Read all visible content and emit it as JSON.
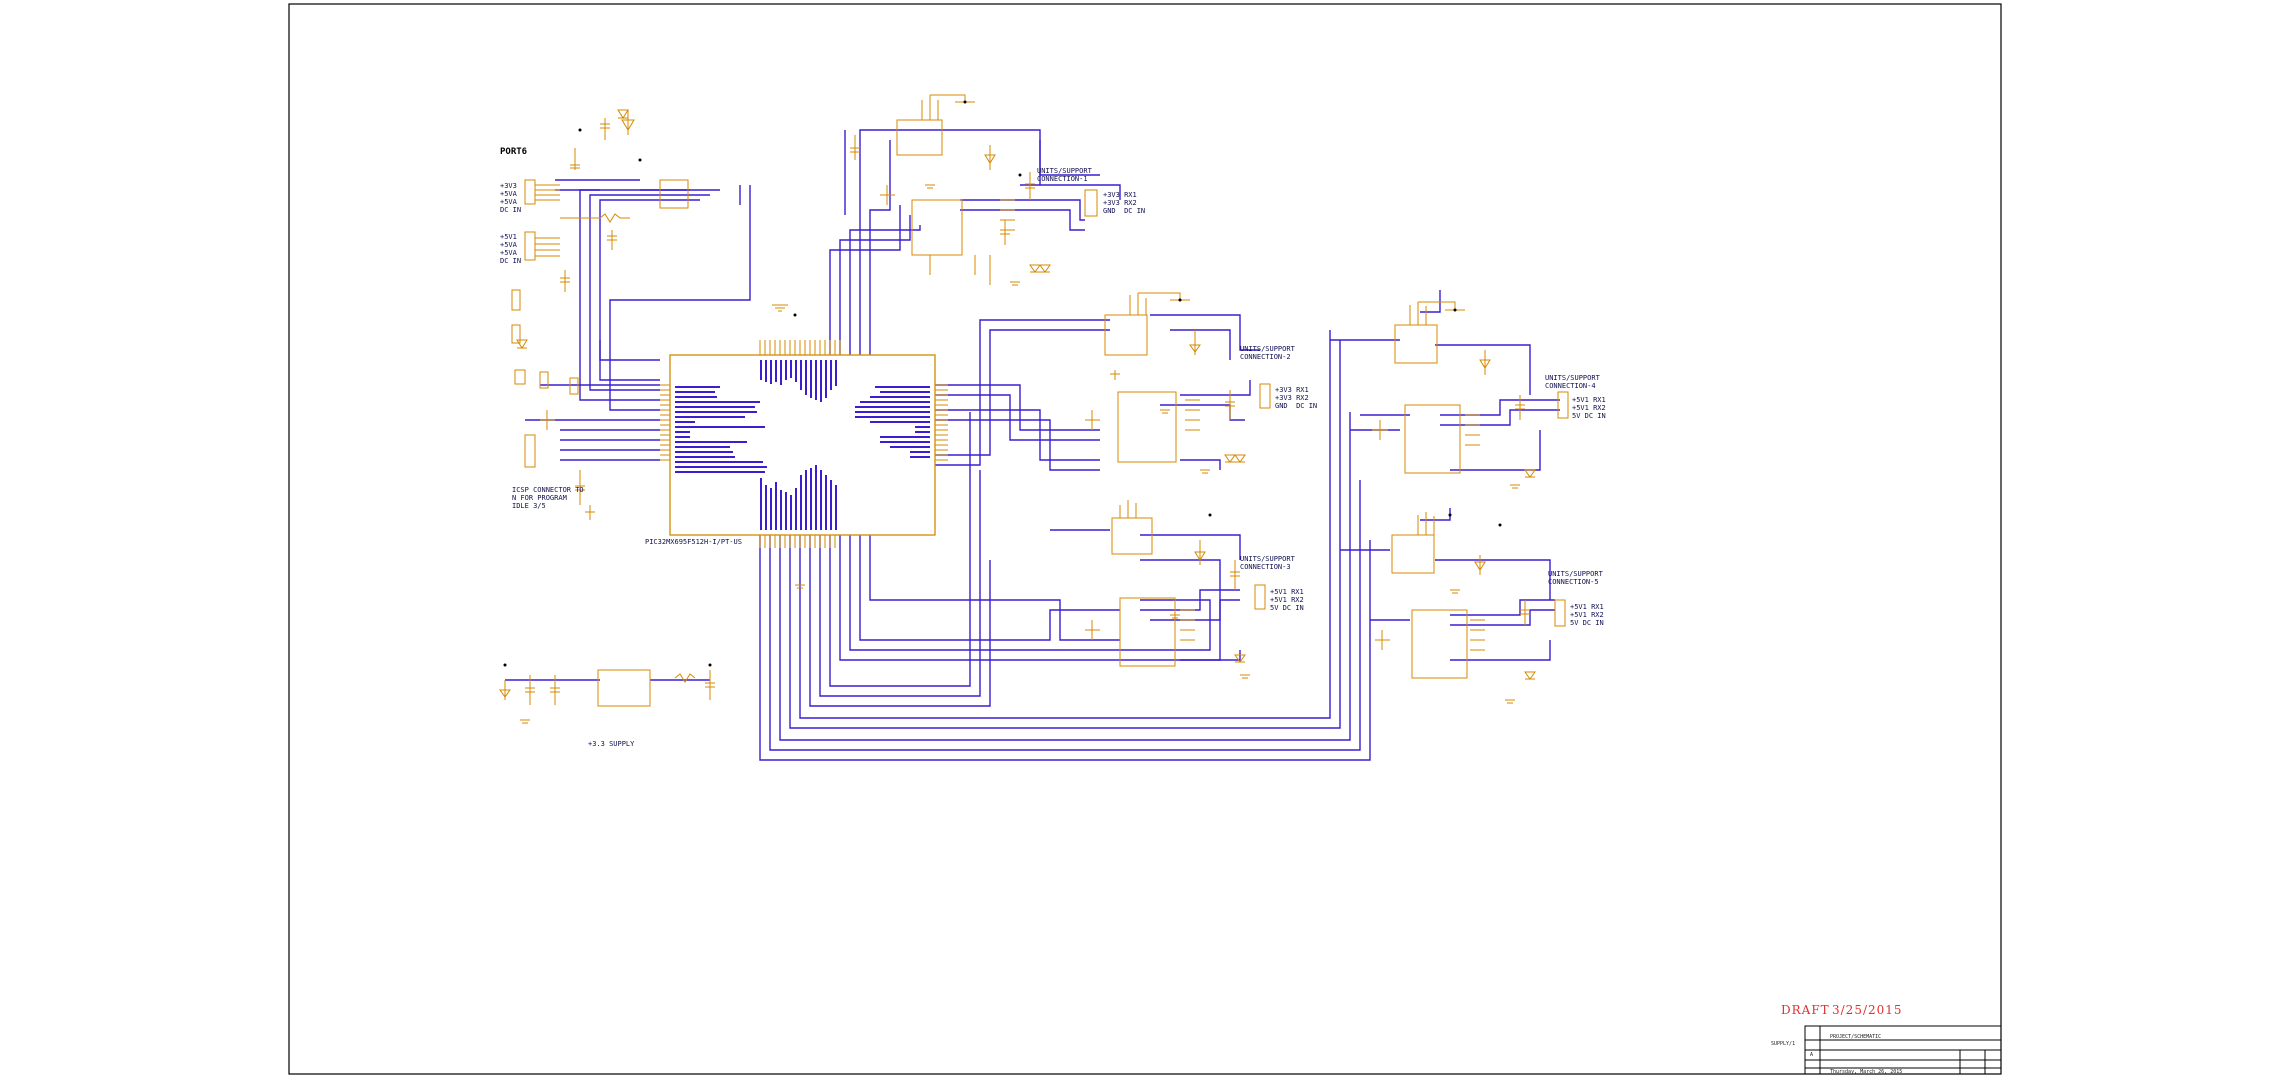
{
  "colors": {
    "wire": "#3a1ed0",
    "component": "#d48a00",
    "text": "#101050",
    "draft": "#e03030",
    "frame": "#000000"
  },
  "headings": {
    "port6": "PORT6",
    "supply": "+3.3 SUPPLY"
  },
  "blocks": {
    "port6_power": "+3V3\n+5VA\n+5VA\nDC IN",
    "port6_input": "+5V1\n+5VA\n+5VA\nDC IN",
    "icsp": "ICSP CONNECTOR TO\nN FOR PROGRAM\nIDLE 3/5",
    "conn1": "UNITS/SUPPORT\nCONNECTION-1",
    "conn2": "UNITS/SUPPORT\nCONNECTION-2",
    "conn3": "UNITS/SUPPORT\nCONNECTION-3",
    "conn4": "UNITS/SUPPORT\nCONNECTION-4",
    "conn5": "UNITS/SUPPORT\nCONNECTION-5",
    "conn_pins_a": "+3V3 RX1\n+3V3 RX2\nGND  DC IN",
    "conn_pins_b": "+5V1 RX1\n+5V1 RX2\n5V DC IN",
    "mcu_part": "PIC32MX695F512H-I/PT-US"
  },
  "draft": {
    "label": "DRAFT",
    "date": "3/25/2015"
  },
  "title_block": {
    "sheet_label": "SUPPLY/1",
    "title": "PROJECT/SCHEMATIC",
    "size": "A",
    "date_line": "Thursday, March 26, 2015"
  }
}
